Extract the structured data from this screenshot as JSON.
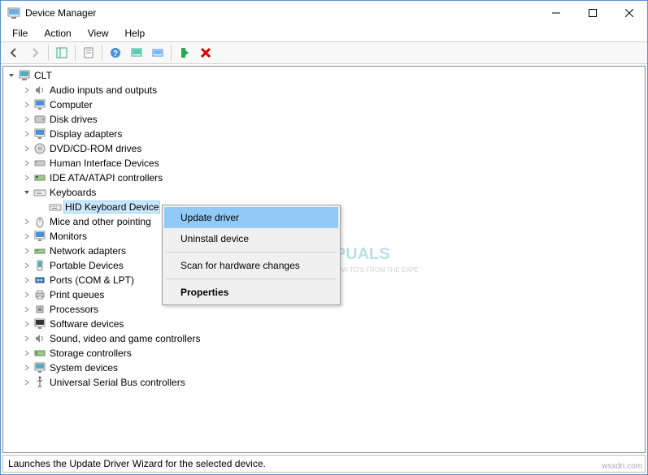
{
  "window": {
    "title": "Device Manager"
  },
  "menubar": [
    "File",
    "Action",
    "View",
    "Help"
  ],
  "tree": {
    "root": "CLT",
    "children": [
      "Audio inputs and outputs",
      "Computer",
      "Disk drives",
      "Display adapters",
      "DVD/CD-ROM drives",
      "Human Interface Devices",
      "IDE ATA/ATAPI controllers"
    ],
    "keyboards": {
      "label": "Keyboards",
      "child": "HID Keyboard Device"
    },
    "children2": [
      "Mice and other pointing",
      "Monitors",
      "Network adapters",
      "Portable Devices",
      "Ports (COM & LPT)",
      "Print queues",
      "Processors",
      "Software devices",
      "Sound, video and game controllers",
      "Storage controllers",
      "System devices",
      "Universal Serial Bus controllers"
    ]
  },
  "contextmenu": {
    "update": "Update driver",
    "uninstall": "Uninstall device",
    "scan": "Scan for hardware changes",
    "properties": "Properties"
  },
  "statusbar": "Launches the Update Driver Wizard for the selected device.",
  "watermark": {
    "brand": "APPUALS",
    "tagline": "TECH HOW-TO'S FROM THE EXPERTS!"
  },
  "corner": "wsxdn.com"
}
